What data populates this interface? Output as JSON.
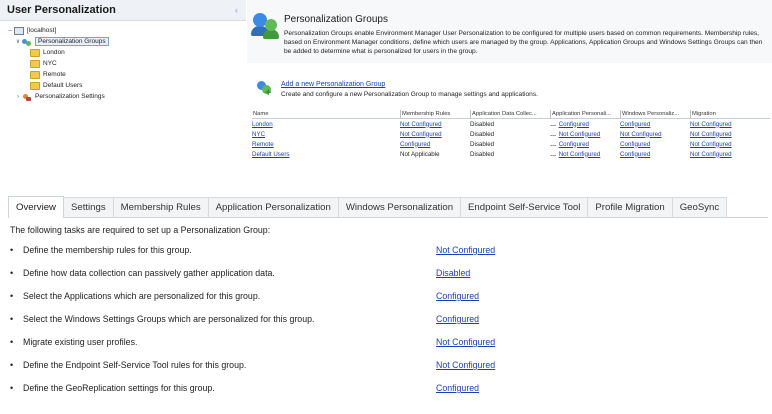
{
  "tree": {
    "title": "User Personalization",
    "collapse_icon": "chevron-left-icon",
    "nodes": {
      "localhost": "[localhost]",
      "groups": "Personalization Groups",
      "london": "London",
      "nyc": "NYC",
      "remote": "Remote",
      "default_users": "Default Users",
      "settings": "Personalization Settings"
    }
  },
  "intro": {
    "title": "Personalization Groups",
    "description": "Personalization Groups enable Environment Manager User Personalization to be configured for multiple users based on common requirements. Membership rules, based on Environment Manager conditions, define which users are managed by the group. Applications, Application Groups and Windows Settings Groups can then be added to determine what is personalized for users in the group."
  },
  "add_group": {
    "link": "Add a new Personalization Group",
    "description": "Create and configure a new Personalization Group to manage settings and applications."
  },
  "grid": {
    "columns": [
      "Name",
      "Membership Rules",
      "Application Data Collec...",
      "Application Personali...",
      "Windows Personaliz...",
      "Migration"
    ],
    "rows": [
      {
        "name": "London",
        "membership": "Not Configured",
        "collection": "Disabled",
        "app": "Configured",
        "windows": "Configured",
        "migration": "Not Configured"
      },
      {
        "name": "NYC",
        "membership": "Not Configured",
        "collection": "Disabled",
        "app": "Not Configured",
        "windows": "Not Configured",
        "migration": "Not Configured"
      },
      {
        "name": "Remote",
        "membership": "Configured",
        "collection": "Disabled",
        "app": "Configured",
        "windows": "Configured",
        "migration": "Not Configured"
      },
      {
        "name": "Default Users",
        "membership": "Not Applicable",
        "collection": "Disabled",
        "app": "Not Configured",
        "windows": "Configured",
        "migration": "Not Configured"
      }
    ],
    "ellipsis": "…"
  },
  "overview": {
    "tabs": [
      "Overview",
      "Settings",
      "Membership Rules",
      "Application Personalization",
      "Windows Personalization",
      "Endpoint Self-Service Tool",
      "Profile Migration",
      "GeoSync"
    ],
    "active_tab": "Overview",
    "intro": "The following tasks are required to set up a Personalization Group:",
    "bullet": "•",
    "tasks": [
      {
        "text": "Define the membership rules for this group.",
        "status": "Not Configured"
      },
      {
        "text": "Define how data collection can passively gather application data.",
        "status": "Disabled"
      },
      {
        "text": "Select the Applications which are personalized for this group.",
        "status": "Configured"
      },
      {
        "text": "Select the Windows Settings Groups which are personalized for this group.",
        "status": "Configured"
      },
      {
        "text": "Migrate existing user profiles.",
        "status": "Not Configured"
      },
      {
        "text": "Define the Endpoint Self-Service Tool rules for this group.",
        "status": "Not Configured"
      },
      {
        "text": "Define the GeoReplication settings for this group.",
        "status": "Configured"
      }
    ]
  },
  "colors": {
    "link": "#1a3fb4",
    "folder": "#f2c94c",
    "header_bg": "#eef1f5"
  }
}
